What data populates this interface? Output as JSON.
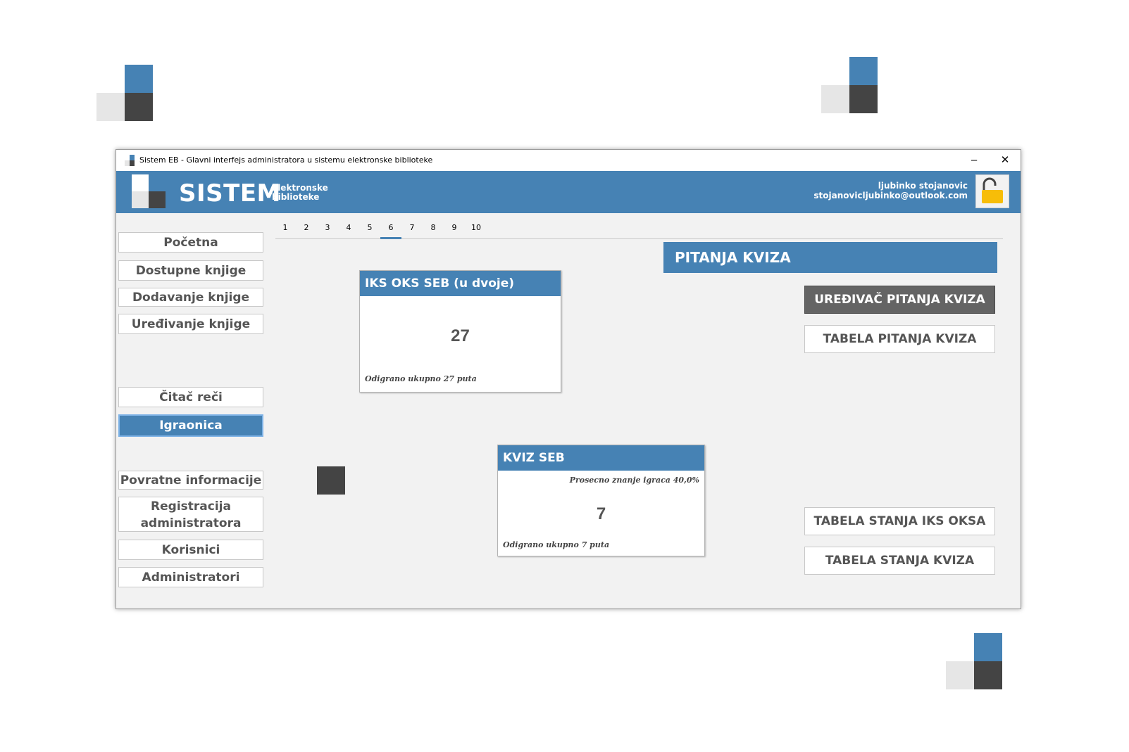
{
  "colors": {
    "accent": "#4682b4",
    "dark": "#444444",
    "light": "#e6e6e6",
    "lock": "#f7bd08"
  },
  "window": {
    "title": "Sistem EB - Glavni interfejs administratora u sistemu elektronske biblioteke",
    "minimize_glyph": "–",
    "close_glyph": "✕"
  },
  "header": {
    "brand": "SISTEM",
    "brand_sub_1": "Elektronske",
    "brand_sub_2": "biblioteke",
    "user_name": "ljubinko stojanovic",
    "user_email": "stojanovicljubinko@outlook.com",
    "lock_icon": "unlocked-padlock-icon"
  },
  "sidebar": {
    "items": [
      {
        "label": "Početna"
      },
      {
        "label": "Dostupne knjige"
      },
      {
        "label": "Dodavanje knjige"
      },
      {
        "label": "Uređivanje knjige"
      },
      {
        "label": "Čitač reči"
      },
      {
        "label": "Igraonica",
        "active": true
      },
      {
        "label": "Povratne informacije"
      },
      {
        "label": "Registracija administratora"
      },
      {
        "label": "Korisnici"
      },
      {
        "label": "Administratori"
      }
    ]
  },
  "tabs": [
    "1",
    "2",
    "3",
    "4",
    "5",
    "6",
    "7",
    "8",
    "9",
    "10"
  ],
  "active_tab": "6",
  "cards": {
    "iks": {
      "title": "IKS OKS SEB (u dvoje)",
      "count": "27",
      "footer": "Odigrano ukupno 27 puta"
    },
    "kviz": {
      "title": "KVIZ SEB",
      "average": "Prosecno znanje igraca 40,0%",
      "count": "7",
      "footer": "Odigrano ukupno 7 puta"
    }
  },
  "panel": {
    "title": "PITANJA KVIZA",
    "editor_button": "UREĐIVAČ PITANJA KVIZA",
    "questions_table_button": "TABELA PITANJA KVIZA",
    "iks_table_button": "TABELA STANJA IKS OKSA",
    "kviz_table_button": "TABELA STANJA KVIZA"
  }
}
